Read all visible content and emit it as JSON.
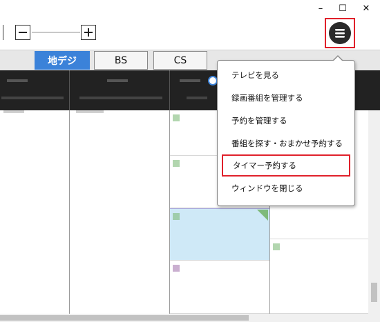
{
  "window": {
    "minimize_glyph": "–",
    "maximize_glyph": "☐",
    "close_glyph": "✕"
  },
  "toolbar": {
    "zoom_out_icon": "minus-icon",
    "zoom_in_icon": "plus-icon",
    "menu_icon": "hamburger-icon"
  },
  "tabs": [
    {
      "label": "地デジ",
      "active": true
    },
    {
      "label": "BS",
      "active": false
    },
    {
      "label": "CS",
      "active": false
    }
  ],
  "menu": {
    "items": [
      {
        "label": "テレビを見る",
        "selected": false
      },
      {
        "label": "録画番組を管理する",
        "selected": false
      },
      {
        "label": "予約を管理する",
        "selected": false
      },
      {
        "label": "番組を探す・おまかせ予約する",
        "selected": false
      },
      {
        "label": "タイマー予約する",
        "selected": true
      },
      {
        "label": "ウィンドウを閉じる",
        "selected": false
      }
    ]
  },
  "colors": {
    "accent": "#3b82d9",
    "highlight_border": "#e0202a",
    "header_bg": "#222222"
  }
}
